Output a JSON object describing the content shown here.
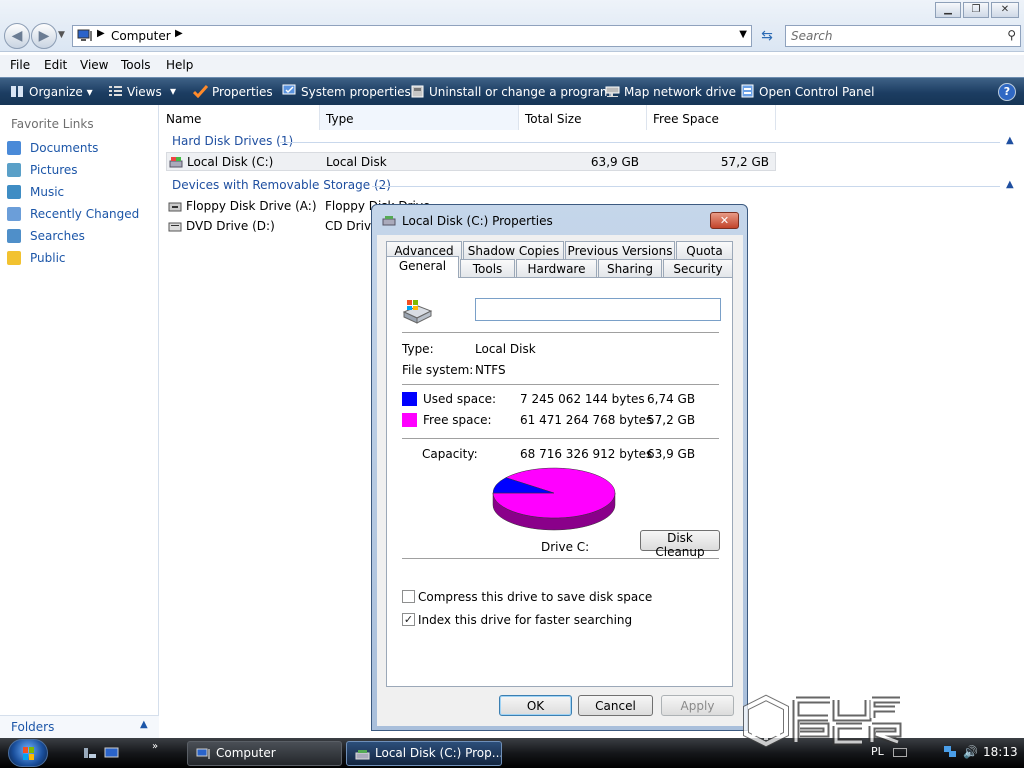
{
  "window": {
    "address_path": "Computer",
    "search_placeholder": "Search",
    "minimize": "▁",
    "maximize": "❐",
    "close": "✕"
  },
  "menu": [
    "File",
    "Edit",
    "View",
    "Tools",
    "Help"
  ],
  "toolbar": {
    "organize": "Organize",
    "views": "Views",
    "properties": "Properties",
    "system_properties": "System properties",
    "uninstall": "Uninstall or change a program",
    "map_drive": "Map network drive",
    "control_panel": "Open Control Panel",
    "help": "?"
  },
  "sidebar": {
    "title": "Favorite Links",
    "items": [
      {
        "label": "Documents",
        "icon": "documents-icon"
      },
      {
        "label": "Pictures",
        "icon": "pictures-icon"
      },
      {
        "label": "Music",
        "icon": "music-icon"
      },
      {
        "label": "Recently Changed",
        "icon": "recently-changed-icon"
      },
      {
        "label": "Searches",
        "icon": "searches-icon"
      },
      {
        "label": "Public",
        "icon": "public-folder-icon"
      }
    ],
    "folders": "Folders"
  },
  "columns": [
    "Name",
    "Type",
    "Total Size",
    "Free Space"
  ],
  "groups": {
    "hdd": "Hard Disk Drives (1)",
    "removable": "Devices with Removable Storage (2)"
  },
  "drives": {
    "c": {
      "name": "Local Disk (C:)",
      "type": "Local Disk",
      "total": "63,9 GB",
      "free": "57,2 GB"
    },
    "a": {
      "name": "Floppy Disk Drive (A:)",
      "type": "Floppy Disk Drive"
    },
    "d": {
      "name": "DVD Drive (D:)",
      "type": "CD Drive"
    }
  },
  "dialog": {
    "title": "Local Disk (C:) Properties",
    "close": "✕",
    "tabs_top": [
      "Advanced",
      "Shadow Copies",
      "Previous Versions",
      "Quota"
    ],
    "tabs_bottom": [
      "General",
      "Tools",
      "Hardware",
      "Sharing",
      "Security"
    ],
    "volume_label_value": "",
    "type_label": "Type:",
    "type_value": "Local Disk",
    "fs_label": "File system:",
    "fs_value": "NTFS",
    "used_label": "Used space:",
    "used_bytes": "7 245 062 144 bytes",
    "used_gb": "6,74 GB",
    "free_label": "Free space:",
    "free_bytes": "61 471 264 768 bytes",
    "free_gb": "57,2 GB",
    "cap_label": "Capacity:",
    "cap_bytes": "68 716 326 912 bytes",
    "cap_gb": "63,9 GB",
    "drive_label": "Drive C:",
    "cleanup": "Disk Cleanup",
    "compress": "Compress this drive to save disk space",
    "compress_checked": false,
    "index": "Index this drive for faster searching",
    "index_checked": true,
    "ok": "OK",
    "cancel": "Cancel",
    "apply": "Apply",
    "used_color": "#0000ff",
    "free_color": "#ff00ff",
    "used_fraction": 0.1054
  },
  "taskbar": {
    "tasks": [
      "Computer",
      "Local Disk (C:) Prop..."
    ],
    "lang": "PL",
    "clock": "18:13",
    "more": "»"
  }
}
